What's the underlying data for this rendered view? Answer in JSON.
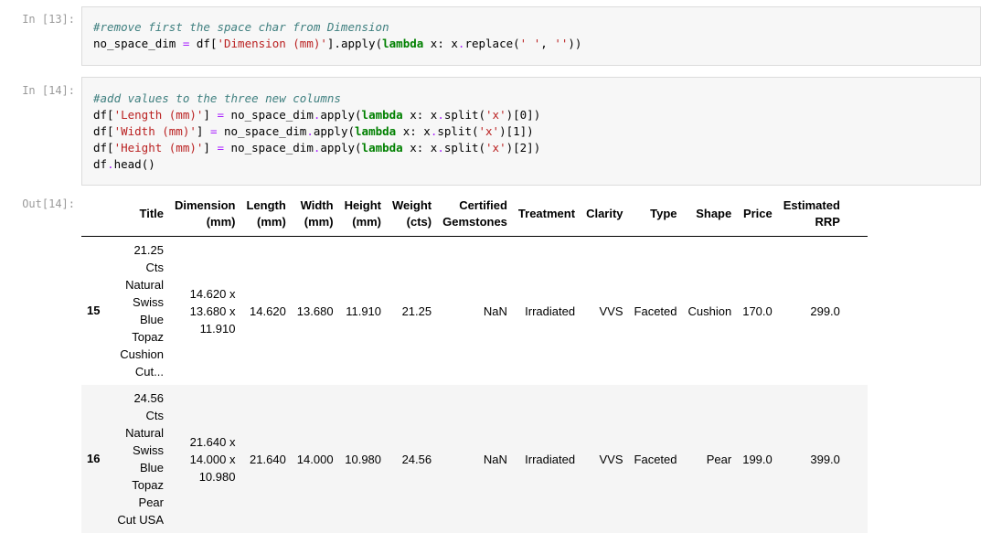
{
  "cells": [
    {
      "prompt": "In [13]:",
      "comment": "#remove first the space char from Dimension",
      "line1": {
        "a": "no_space_dim ",
        "eq": "=",
        "b": " df[",
        "s1": "'Dimension (mm)'",
        "c": "].apply(",
        "kw": "lambda",
        "d": " x: x",
        "dot": ".",
        "e": "replace(",
        "s2": "' '",
        "f": ", ",
        "s3": "''",
        "g": "))"
      }
    },
    {
      "prompt": "In [14]:",
      "comment": "#add values to the three new columns",
      "lines": [
        {
          "a": "df[",
          "s1": "'Length (mm)'",
          "b": "] ",
          "eq": "=",
          "c": " no_space_dim",
          "dot": ".",
          "d": "apply(",
          "kw": "lambda",
          "e": " x: x",
          "dot2": ".",
          "f": "split(",
          "s2": "'x'",
          "g": ")[0])"
        },
        {
          "a": "df[",
          "s1": "'Width (mm)'",
          "b": "] ",
          "eq": "=",
          "c": " no_space_dim",
          "dot": ".",
          "d": "apply(",
          "kw": "lambda",
          "e": " x: x",
          "dot2": ".",
          "f": "split(",
          "s2": "'x'",
          "g": ")[1])"
        },
        {
          "a": "df[",
          "s1": "'Height (mm)'",
          "b": "] ",
          "eq": "=",
          "c": " no_space_dim",
          "dot": ".",
          "d": "apply(",
          "kw": "lambda",
          "e": " x: x",
          "dot2": ".",
          "f": "split(",
          "s2": "'x'",
          "g": ")[2])"
        }
      ],
      "last": {
        "a": "df",
        "dot": ".",
        "b": "head()"
      }
    }
  ],
  "output": {
    "prompt": "Out[14]:",
    "headers": [
      {
        "l1": "Title",
        "l2": ""
      },
      {
        "l1": "Dimension",
        "l2": "(mm)"
      },
      {
        "l1": "Length",
        "l2": "(mm)"
      },
      {
        "l1": "Width",
        "l2": "(mm)"
      },
      {
        "l1": "Height",
        "l2": "(mm)"
      },
      {
        "l1": "Weight",
        "l2": "(cts)"
      },
      {
        "l1": "Certified",
        "l2": "Gemstones"
      },
      {
        "l1": "Treatment",
        "l2": ""
      },
      {
        "l1": "Clarity",
        "l2": ""
      },
      {
        "l1": "Type",
        "l2": ""
      },
      {
        "l1": "Shape",
        "l2": ""
      },
      {
        "l1": "Price",
        "l2": ""
      },
      {
        "l1": "Estimated",
        "l2": "RRP"
      }
    ],
    "rows": [
      {
        "index": "15",
        "title_lines": [
          "21.25 Cts",
          "Natural",
          "Swiss Blue",
          "Topaz",
          "Cushion",
          "Cut..."
        ],
        "dimension_lines": [
          "14.620 x",
          "13.680 x",
          "11.910"
        ],
        "length": "14.620",
        "width": "13.680",
        "height": "11.910",
        "weight": "21.25",
        "certified": "NaN",
        "treatment": "Irradiated",
        "clarity": "VVS",
        "type": "Faceted",
        "shape": "Cushion",
        "price": "170.0",
        "rrp": "299.0"
      },
      {
        "index": "16",
        "title_lines": [
          "24.56 Cts",
          "Natural",
          "Swiss Blue",
          "Topaz Pear",
          "Cut USA"
        ],
        "dimension_lines": [
          "21.640 x",
          "14.000 x",
          "10.980"
        ],
        "length": "21.640",
        "width": "14.000",
        "height": "10.980",
        "weight": "24.56",
        "certified": "NaN",
        "treatment": "Irradiated",
        "clarity": "VVS",
        "type": "Faceted",
        "shape": "Pear",
        "price": "199.0",
        "rrp": "399.0"
      }
    ]
  }
}
